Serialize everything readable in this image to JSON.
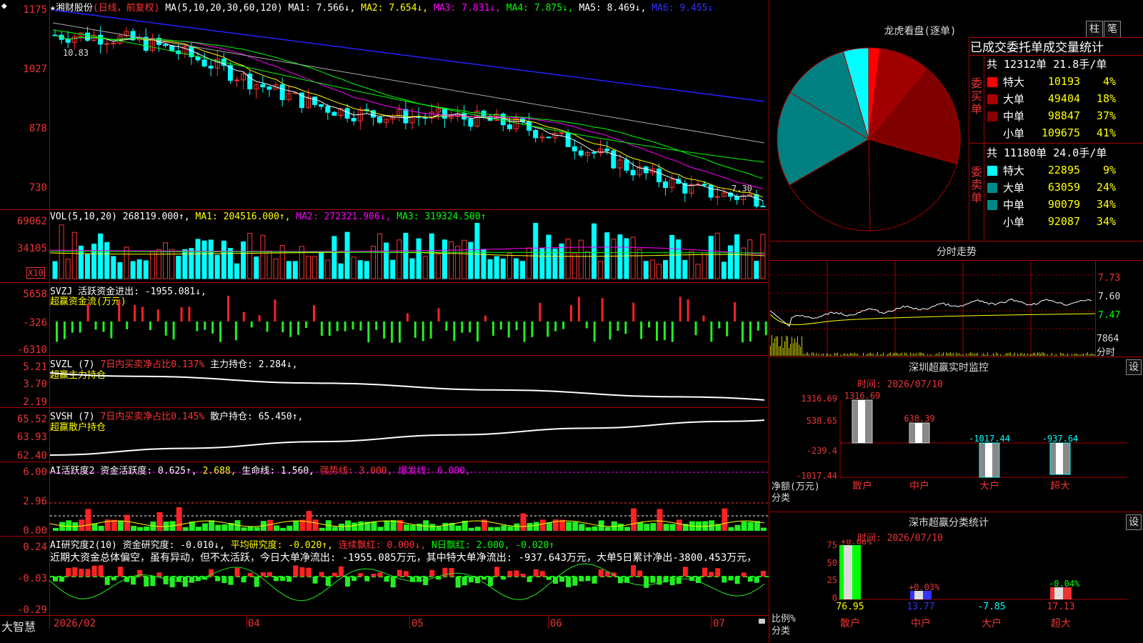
{
  "stock": {
    "name": "湘财股份",
    "mode": "(日线，前复权)"
  },
  "main_ma": {
    "label": "MA(5,10,20,30,60,120)",
    "ma1": "MA1: 7.566↓,",
    "ma2": "MA2: 7.654↓,",
    "ma3": "MA3: 7.831↓,",
    "ma4": "MA4: 7.875↓,",
    "ma5": "MA5: 8.469↓,",
    "ma6": "MA6: 9.455↓",
    "y_ticks": [
      "1175",
      "1027",
      "878",
      "730"
    ],
    "high_label": "10.83",
    "last_label": "7.30"
  },
  "vol": {
    "label": "VOL(5,10,20)",
    "value": "268119.000↑,",
    "ma1": "MA1: 204516.000↑,",
    "ma2": "MA2: 272321.906↓,",
    "ma3": "MA3: 319324.500↑",
    "y_ticks": [
      "69062",
      "34105"
    ],
    "unit": "X10"
  },
  "svzj": {
    "label": "SVZJ",
    "text": "活跃资金进出: -1955.081↓,",
    "sub": "超赢资金流(万元)",
    "y_ticks": [
      "5658",
      "-326",
      "-6310"
    ]
  },
  "svzl": {
    "label": "SVZL (7)",
    "pct": "7日内买卖净占比0.137%",
    "hold": "主力持仓: 2.284↓,",
    "sub": "超赢主力持仓",
    "y_ticks": [
      "5.21",
      "3.70",
      "2.19"
    ]
  },
  "svsh": {
    "label": "SVSH (7)",
    "pct": "7日内买卖净占比0.145%",
    "hold": "散户持仓: 65.450↑,",
    "sub": "超赢散户持仓",
    "y_ticks": [
      "65.52",
      "63.93",
      "62.40"
    ]
  },
  "ai1": {
    "label": "AI活跃度2",
    "a": "资金活跃度: 0.625↑,",
    "b": "2.688,",
    "c": "生命线: 1.560,",
    "d": "强势线: 3.000,",
    "e": "爆发线: 6.000,",
    "y_ticks": [
      "6.00",
      "2.96",
      "0.00"
    ]
  },
  "ai2": {
    "label": "AI研究度2(10)",
    "a": "资金研究度: -0.010↓,",
    "b": "平均研究度: -0.020↑,",
    "c": "连续飘红: 0.000↓,",
    "d": "N日飘红: 2.000,",
    "e": "-0.020↑",
    "note": "近期大资金总体偏空，虽有异动，但不太活跃，今日大单净流出: -1955.085万元，其中特大单净流出: -937.643万元，大单5日累计净出-3800.453万元，",
    "y_ticks": [
      "0.24",
      "-0.03",
      "-0.29"
    ]
  },
  "xaxis": {
    "labels": [
      "2026/02",
      "04",
      "05",
      "06",
      "07"
    ],
    "brand": "大智慧"
  },
  "dragon": {
    "title": "龙虎看盘(逐单)",
    "btn1": "柱",
    "btn2": "笔",
    "heading": "已成交委托单成交量统计",
    "buy_title": "委买单",
    "sell_title": "委卖单",
    "buy_total": "共 12312单 21.8手/单",
    "sell_total": "共 11180单 24.0手/单",
    "buy": [
      {
        "name": "特大",
        "vol": "10193",
        "pct": "4%",
        "color": "#ff0000"
      },
      {
        "name": "大单",
        "vol": "49404",
        "pct": "18%",
        "color": "#a00000"
      },
      {
        "name": "中单",
        "vol": "98847",
        "pct": "37%",
        "color": "#800000"
      },
      {
        "name": "小单",
        "vol": "109675",
        "pct": "41%",
        "color": "#000000"
      }
    ],
    "sell": [
      {
        "name": "特大",
        "vol": "22895",
        "pct": "9%",
        "color": "#00ffff"
      },
      {
        "name": "大单",
        "vol": "63059",
        "pct": "24%",
        "color": "#008080"
      },
      {
        "name": "中单",
        "vol": "90079",
        "pct": "34%",
        "color": "#008080"
      },
      {
        "name": "小单",
        "vol": "92087",
        "pct": "34%",
        "color": "#000000"
      }
    ]
  },
  "intraday": {
    "title": "分时走势",
    "y_ticks": [
      "7.73",
      "7.60",
      "7.47"
    ],
    "vol_label": "7864",
    "unit": "分时"
  },
  "monitor": {
    "title": "深圳超赢实时监控",
    "btn": "设",
    "time": "时间: 2026/07/10",
    "y_ticks": [
      "1316.69",
      "538.65",
      "-239.4",
      "-1017.44"
    ],
    "y_caption": "净额(万元)",
    "x_caption": "分类",
    "cats": [
      "散户",
      "中户",
      "大户",
      "超大"
    ],
    "values": [
      "1316.69",
      "638.39",
      "-1017.44",
      "-937.64"
    ]
  },
  "classify": {
    "title": "深市超赢分类统计",
    "btn": "设",
    "time": "时间: 2026/07/10",
    "y_ticks": [
      "75",
      "50",
      "25",
      "0"
    ],
    "y_caption": "比例%",
    "x_caption": "分类",
    "cats": [
      "散户",
      "中户",
      "大户",
      "超大"
    ],
    "bottoms": [
      "76.95",
      "13.77",
      "-7.85",
      "17.13"
    ],
    "tops": [
      "+0.06%",
      "+0.03%",
      "",
      "-0.04%"
    ]
  }
}
